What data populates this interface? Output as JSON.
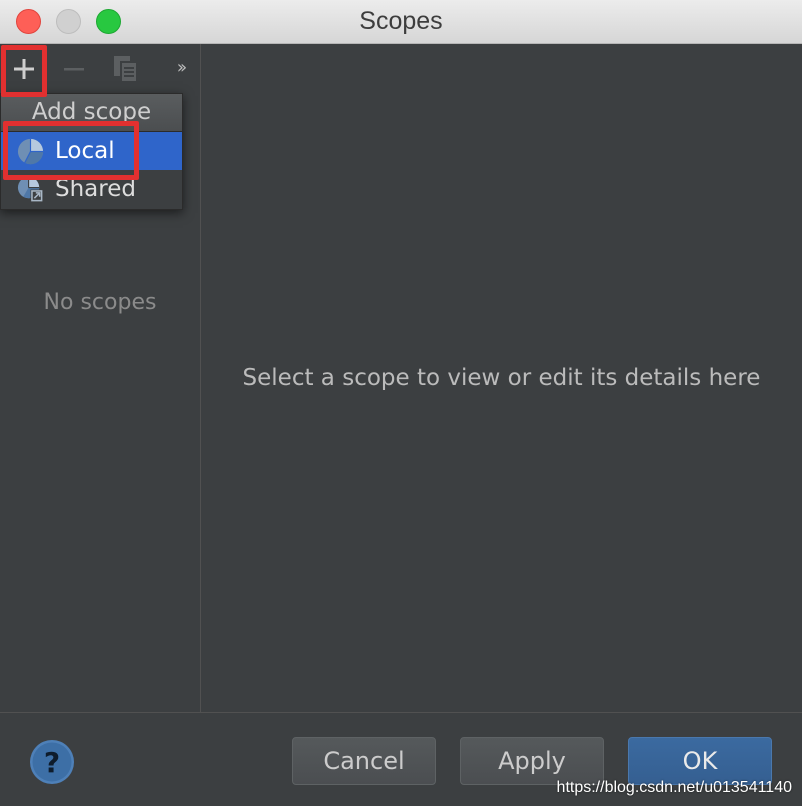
{
  "window": {
    "title": "Scopes"
  },
  "toolbar": {
    "add_icon": "plus-icon",
    "remove_icon": "minus-icon",
    "copy_icon": "copy-icon",
    "more_label": "››"
  },
  "popup": {
    "header": "Add scope",
    "items": [
      {
        "label": "Local",
        "icon": "local-scope-icon",
        "selected": true
      },
      {
        "label": "Shared",
        "icon": "shared-scope-icon",
        "selected": false
      }
    ]
  },
  "left_panel": {
    "empty_text": "No scopes"
  },
  "main": {
    "placeholder": "Select a scope to view or edit its details here"
  },
  "footer": {
    "help_label": "?",
    "cancel_label": "Cancel",
    "apply_label": "Apply",
    "ok_label": "OK",
    "watermark": "https://blog.csdn.net/u013541140"
  },
  "colors": {
    "background": "#3c3f41",
    "selection": "#2f65ca",
    "highlight": "#e23030",
    "primary_button": "#365f92"
  }
}
